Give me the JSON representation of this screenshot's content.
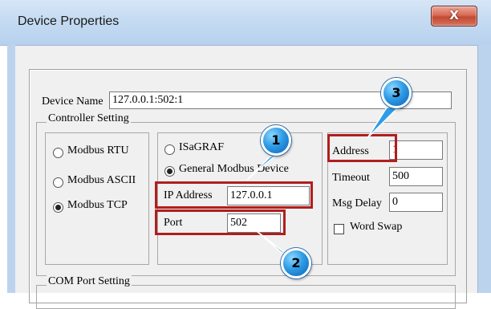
{
  "window": {
    "title": "Device Properties",
    "close_glyph": "X"
  },
  "device_name": {
    "label": "Device Name",
    "value": "127.0.0.1:502:1"
  },
  "controller_setting": {
    "legend": "Controller Setting",
    "protocol_options": [
      {
        "label": "Modbus RTU",
        "selected": false
      },
      {
        "label": "Modbus ASCII",
        "selected": false
      },
      {
        "label": "Modbus TCP",
        "selected": true
      }
    ],
    "device_type_options": [
      {
        "label": "ISaGRAF",
        "selected": false
      },
      {
        "label": "General Modbus Device",
        "selected": true
      }
    ],
    "ip_address": {
      "label": "IP Address",
      "value": "127.0.0.1"
    },
    "port": {
      "label": "Port",
      "value": "502"
    },
    "address": {
      "label": "Address",
      "value": "1"
    },
    "timeout": {
      "label": "Timeout",
      "value": "500"
    },
    "msg_delay": {
      "label": "Msg Delay",
      "value": "0"
    },
    "word_swap": {
      "label": "Word Swap",
      "checked": false
    }
  },
  "com_port_setting": {
    "legend": "COM Port Setting"
  },
  "callouts": [
    {
      "number": "1"
    },
    {
      "number": "2"
    },
    {
      "number": "3"
    }
  ],
  "colors": {
    "highlight_border": "#b01e1e",
    "callout_blue": "#2f9ce6",
    "dialog_bg": "#f0f0f0"
  }
}
